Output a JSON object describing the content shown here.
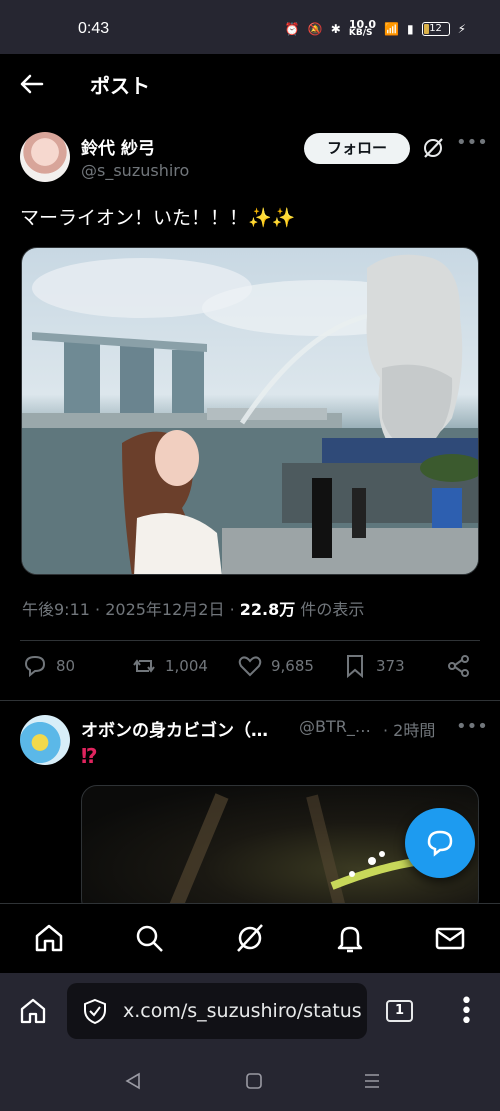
{
  "status_bar": {
    "time": "0:43",
    "net_speed_top": "10.0",
    "net_speed_unit": "KB/S",
    "battery": "12"
  },
  "header": {
    "title": "ポスト"
  },
  "post": {
    "author_name": "鈴代 紗弓",
    "author_handle": "@s_suzushiro",
    "follow_label": "フォロー",
    "text": "マーライオン！いた！！！✨✨",
    "time": "午後9:11",
    "date": "2025年12月2日",
    "views_count": "22.8万",
    "views_label": "件の表示",
    "counts": {
      "replies": "80",
      "reposts": "1,004",
      "likes": "9,685",
      "bookmarks": "373"
    }
  },
  "reply": {
    "name": "オボンの身カビゴン（…",
    "handle": "@BTR_…",
    "time": "· 2時間",
    "text": "⁉"
  },
  "browser": {
    "url": "x.com/s_suzushiro/status",
    "tab_count": "1"
  },
  "colors": {
    "accent": "#1d9bf0",
    "background": "#000000",
    "muted": "#71767b"
  }
}
